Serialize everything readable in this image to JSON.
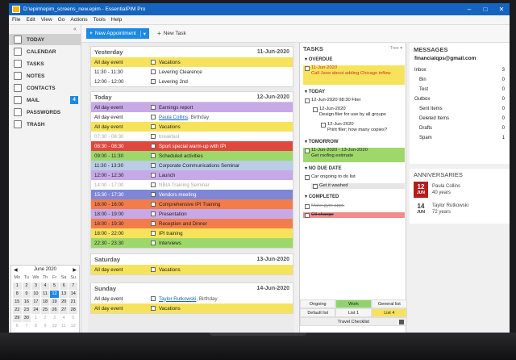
{
  "window": {
    "title": "D:\\epim\\epim_screens_new.epim - EssentialPIM Pro"
  },
  "menu": [
    "File",
    "Edit",
    "View",
    "Go",
    "Actions",
    "Tools",
    "Help"
  ],
  "nav": [
    {
      "label": "TODAY",
      "icon": "today-icon"
    },
    {
      "label": "CALENDAR",
      "icon": "calendar-icon"
    },
    {
      "label": "TASKS",
      "icon": "tasks-icon"
    },
    {
      "label": "NOTES",
      "icon": "notes-icon"
    },
    {
      "label": "CONTACTS",
      "icon": "contacts-icon"
    },
    {
      "label": "MAIL",
      "icon": "mail-icon",
      "badge": "4"
    },
    {
      "label": "PASSWORDS",
      "icon": "key-icon"
    },
    {
      "label": "TRASH",
      "icon": "trash-icon"
    }
  ],
  "toolbar": {
    "new_appointment": "New Appointment",
    "new_task": "New Task"
  },
  "minical": {
    "month": "June 2020",
    "headers": [
      "Mo",
      "Tu",
      "We",
      "Th",
      "Fr",
      "Sa",
      "Su"
    ],
    "weeks": [
      [
        "1",
        "2",
        "3",
        "4",
        "5",
        "6",
        "7"
      ],
      [
        "8",
        "9",
        "10",
        "11",
        "12",
        "13",
        "14"
      ],
      [
        "15",
        "16",
        "17",
        "18",
        "19",
        "20",
        "21"
      ],
      [
        "22",
        "23",
        "24",
        "25",
        "26",
        "27",
        "28"
      ],
      [
        "29",
        "30",
        "1",
        "2",
        "3",
        "4",
        "5"
      ],
      [
        "6",
        "7",
        "8",
        "9",
        "10",
        "11",
        "12"
      ]
    ],
    "today": "12"
  },
  "days": {
    "yesterday": {
      "title": "Yesterday",
      "date": "11-Jun-2020",
      "events": [
        {
          "time": "All day event",
          "text": "Vacations",
          "color": "#f7e35b"
        },
        {
          "time": "11:30 - 11:30",
          "text": "Levering Clearence",
          "color": "#ffffff"
        },
        {
          "time": "12:00 - 12:00",
          "text": "Levering 2nd",
          "color": "#ffffff"
        }
      ]
    },
    "today": {
      "title": "Today",
      "date": "12-Jun-2020",
      "events": [
        {
          "time": "All day event",
          "text": "Earnings report",
          "color": "#c7a9e8"
        },
        {
          "time": "All day event",
          "text": "Paula Collins",
          "sub": ", Birthday",
          "link": true,
          "color": "#ffffff"
        },
        {
          "time": "All day event",
          "text": "Vacations",
          "color": "#f7e35b"
        },
        {
          "time": "07:30 - 08:30",
          "text": "breakfast",
          "color": "#ffffff",
          "muted": true
        },
        {
          "time": "08:30 - 08:30",
          "text": "Sport special warm-up with IPI",
          "color": "#e0473e",
          "white": true
        },
        {
          "time": "09:00 - 11:30",
          "text": "Scheduled activities",
          "color": "#9ed86b"
        },
        {
          "time": "11:30 - 13:30",
          "text": "Corporate Communications Seminar",
          "color": "#b9cde6"
        },
        {
          "time": "12:00 - 12:30",
          "text": "Launch",
          "color": "#c7a9e8"
        },
        {
          "time": "14:00 - 17:00",
          "text": "NBIA Training Seminar",
          "color": "#ffffff",
          "muted": true
        },
        {
          "time": "15:30 - 17:30",
          "text": "Vendors meeting",
          "color": "#7e86d8",
          "white": true
        },
        {
          "time": "16:00 - 16:00",
          "text": "Comprehensive IPI Training",
          "color": "#f47c4a"
        },
        {
          "time": "18:00 - 19:00",
          "text": "Presentation",
          "color": "#c7a9e8"
        },
        {
          "time": "18:00 - 19:30",
          "text": "Reception and Dinner",
          "color": "#f47c4a"
        },
        {
          "time": "18:00 - 22:00",
          "text": "IPI training",
          "color": "#f7e35b"
        },
        {
          "time": "22:30 - 23:30",
          "text": "Interviews",
          "color": "#9ed86b"
        }
      ]
    },
    "saturday": {
      "title": "Saturday",
      "date": "13-Jun-2020",
      "events": [
        {
          "time": "All day event",
          "text": "Vacations",
          "color": "#f7e35b"
        }
      ]
    },
    "sunday": {
      "title": "Sunday",
      "date": "14-Jun-2020",
      "events": [
        {
          "time": "All day event",
          "text": "Taylor Rutkowski",
          "sub": ", Birthday",
          "link": true,
          "color": "#ffffff"
        },
        {
          "time": "All day event",
          "text": "Vacations",
          "color": "#f7e35b"
        }
      ]
    }
  },
  "tasks": {
    "title": "TASKS",
    "tree_label": "Tree",
    "sections": {
      "overdue": "OVERDUE",
      "today": "TODAY",
      "tomorrow": "TOMORROW",
      "no_due": "NO DUE DATE",
      "completed": "COMPLETED"
    },
    "items": {
      "overdue_1a": "11-Jun-2020",
      "overdue_1b": "Call Jane about adding Chicago inflow",
      "today_1": "12-Jun-2020 08:30 Filer",
      "today_2a": "12-Jun-2020",
      "today_2b": "Design filer for use by all groups",
      "today_3a": "12-Jun-2020",
      "today_3b": "Print filer; how many copies?",
      "tomorrow_1a": "11-Jun-2020 - 13-Jun-2020",
      "tomorrow_1b": "Get roofing estimate",
      "nodue_1": "Car ongoing to do list",
      "nodue_2": "Get it washed",
      "completed_1": "Make gym appt.",
      "completed_2": "Oil change"
    },
    "tabs": {
      "row1": [
        "Ongoing",
        "Work",
        "General list"
      ],
      "row2": [
        "Default list",
        "List 1",
        "List 4"
      ],
      "travel": "Travel Checklist"
    }
  },
  "messages": {
    "title": "MESSAGES",
    "account": "financialqps@gmail.com",
    "folders": [
      {
        "name": "Inbox",
        "count": "3",
        "indent": false
      },
      {
        "name": "Bin",
        "count": "0",
        "indent": true
      },
      {
        "name": "Test",
        "count": "0",
        "indent": true
      },
      {
        "name": "Outbox",
        "count": "0",
        "indent": false
      },
      {
        "name": "Sent Items",
        "count": "0",
        "indent": true
      },
      {
        "name": "Deleted Items",
        "count": "0",
        "indent": true
      },
      {
        "name": "Drafts",
        "count": "0",
        "indent": true
      },
      {
        "name": "Spam",
        "count": "1",
        "indent": true
      }
    ]
  },
  "anniversaries": {
    "title": "ANNIVERSARIES",
    "items": [
      {
        "day": "12",
        "month": "JUN",
        "name": "Paula Collins",
        "years": "40 years",
        "color": "#b71c1c"
      },
      {
        "day": "14",
        "month": "JUN",
        "name": "Taylor Rutkowski",
        "years": "72 years",
        "color": "#ffffff"
      }
    ]
  }
}
